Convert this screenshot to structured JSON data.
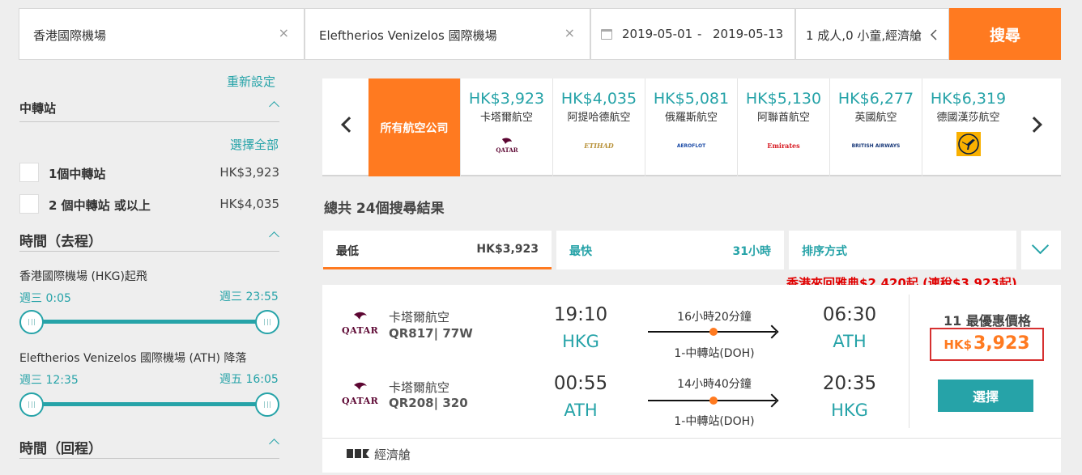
{
  "search": {
    "origin": "香港國際機場",
    "destination": "Eleftherios Venizelos 國際機場",
    "date_from": "2019-05-01",
    "date_sep": "-",
    "date_to": "2019-05-13",
    "travelers": "1 成人,0 小童,經濟艙",
    "clear_icon": "×",
    "search_label": "搜尋"
  },
  "sidebar": {
    "reset": "重新設定",
    "stops": {
      "title": "中轉站",
      "select_all": "選擇全部",
      "options": [
        {
          "label": "1個中轉站",
          "price": "HK$3,923"
        },
        {
          "label": "2 個中轉站 或以上",
          "price": "HK$4,035"
        }
      ]
    },
    "outbound": {
      "title": "時間（去程）",
      "depart_label": "香港國際機場 (HKG)起飛",
      "depart_min": "週三 0:05",
      "depart_max": "週三 23:55",
      "arrive_label": "Eleftherios Venizelos 國際機場 (ATH) 降落",
      "arrive_min": "週三 12:35",
      "arrive_max": "週五 16:05"
    },
    "return": {
      "title": "時間（回程）"
    }
  },
  "airlines": {
    "all_label": "所有航空公司",
    "items": [
      {
        "price": "HK$3,923",
        "name": "卡塔爾航空",
        "logo": "QATAR"
      },
      {
        "price": "HK$4,035",
        "name": "阿提哈德航空",
        "logo": "ETIHAD"
      },
      {
        "price": "HK$5,081",
        "name": "俄羅斯航空",
        "logo": "AEROFLOT"
      },
      {
        "price": "HK$5,130",
        "name": "阿聯酋航空",
        "logo": "Emirates"
      },
      {
        "price": "HK$6,277",
        "name": "英國航空",
        "logo": "BRITISH AIRWAYS"
      },
      {
        "price": "HK$6,319",
        "name": "德國漢莎航空",
        "logo": "lufthansa-crane-icon"
      }
    ]
  },
  "results": {
    "total": "總共 24個搜尋結果",
    "sort": {
      "cheapest_label": "最低",
      "cheapest_value": "HK$3,923",
      "fastest_label": "最快",
      "fastest_value": "31小時",
      "sort_by": "排序方式"
    },
    "promo": "香港來回雅典$2,420起 (連稅$3,923起)",
    "card": {
      "legs": [
        {
          "airline": "卡塔爾航空",
          "flight": "QR817| 77W",
          "dep_time": "19:10",
          "dep_code": "HKG",
          "duration": "16小時20分鐘",
          "stops": "1-中轉站(DOH)",
          "arr_time": "06:30",
          "arr_code": "ATH"
        },
        {
          "airline": "卡塔爾航空",
          "flight": "QR208| 320",
          "dep_time": "00:55",
          "dep_code": "ATH",
          "duration": "14小時40分鐘",
          "stops": "1-中轉站(DOH)",
          "arr_time": "20:35",
          "arr_code": "HKG"
        }
      ],
      "logo_word": "QATAR",
      "deals": "11 最優惠價格",
      "price_currency": "HK$",
      "price_amount": "3,923",
      "select_label": "選擇",
      "cabin": "經濟艙"
    }
  },
  "colors": {
    "accent_orange": "#ff7a20",
    "accent_teal": "#26a3a8",
    "price_border": "#d63030",
    "promo_red": "#e00000"
  }
}
